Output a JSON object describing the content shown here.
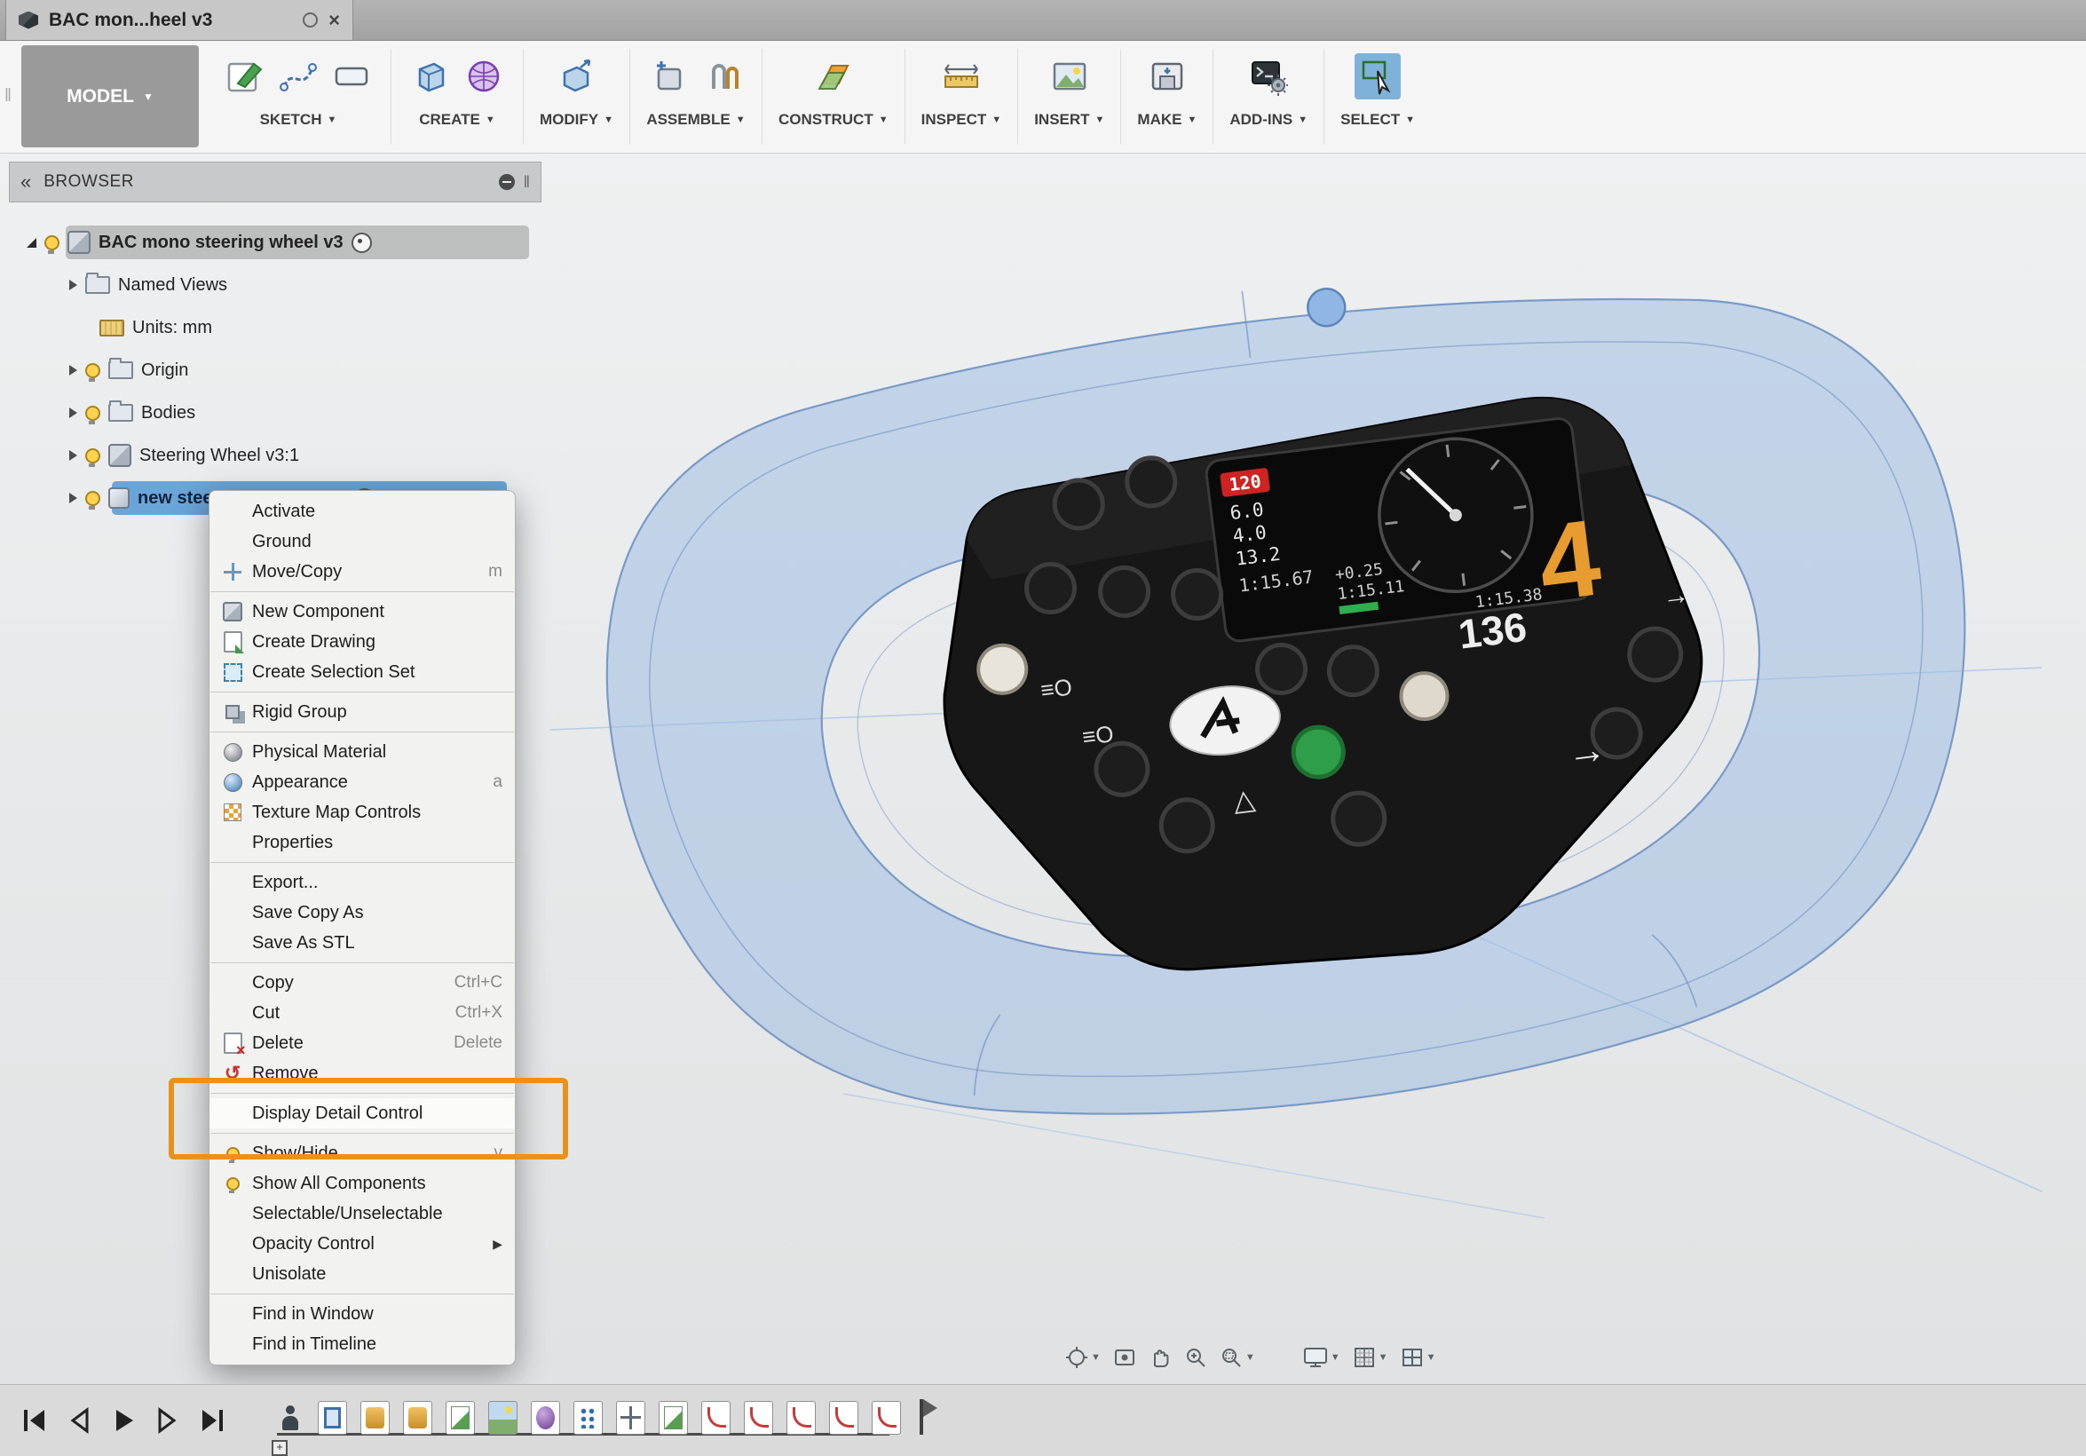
{
  "window": {
    "tab_title": "BAC mon...heel v3"
  },
  "toolbar": {
    "workspace_label": "MODEL",
    "menus": [
      {
        "label": "SKETCH"
      },
      {
        "label": "CREATE"
      },
      {
        "label": "MODIFY"
      },
      {
        "label": "ASSEMBLE"
      },
      {
        "label": "CONSTRUCT"
      },
      {
        "label": "INSPECT"
      },
      {
        "label": "INSERT"
      },
      {
        "label": "MAKE"
      },
      {
        "label": "ADD-INS"
      },
      {
        "label": "SELECT"
      }
    ]
  },
  "browser": {
    "header": "BROWSER",
    "items": [
      {
        "label": "BAC mono steering wheel v3"
      },
      {
        "label": "Named Views"
      },
      {
        "label": "Units: mm"
      },
      {
        "label": "Origin"
      },
      {
        "label": "Bodies"
      },
      {
        "label": "Steering Wheel v3:1"
      },
      {
        "label": "new steering wheel cove"
      }
    ]
  },
  "context_menu": {
    "items": [
      {
        "label": "Activate"
      },
      {
        "label": "Ground"
      },
      {
        "label": "Move/Copy",
        "shortcut": "m"
      },
      {
        "label": "New Component"
      },
      {
        "label": "Create Drawing"
      },
      {
        "label": "Create Selection Set"
      },
      {
        "label": "Rigid Group"
      },
      {
        "label": "Physical Material"
      },
      {
        "label": "Appearance",
        "shortcut": "a"
      },
      {
        "label": "Texture Map Controls"
      },
      {
        "label": "Properties"
      },
      {
        "label": "Export..."
      },
      {
        "label": "Save Copy As"
      },
      {
        "label": "Save As STL"
      },
      {
        "label": "Copy",
        "shortcut": "Ctrl+C"
      },
      {
        "label": "Cut",
        "shortcut": "Ctrl+X"
      },
      {
        "label": "Delete",
        "shortcut": "Delete"
      },
      {
        "label": "Remove"
      },
      {
        "label": "Display Detail Control"
      },
      {
        "label": "Show/Hide",
        "shortcut": "v"
      },
      {
        "label": "Show All Components"
      },
      {
        "label": "Selectable/Unselectable"
      },
      {
        "label": "Opacity Control"
      },
      {
        "label": "Unisolate"
      },
      {
        "label": "Find in Window"
      },
      {
        "label": "Find in Timeline"
      }
    ],
    "highlighted_item": "Display Detail Control",
    "highlight_color": "#E8921C"
  },
  "viewport": {
    "hud": {
      "badge": "120",
      "gear": "4",
      "speed": "136",
      "row1": "6.0",
      "row2": "4.0",
      "row3": "13.2",
      "lap1": "1:15.67",
      "delta": "+0.25",
      "lap2": "1:15.11",
      "lap3": "1:15.38"
    }
  },
  "navbar": {
    "icons": [
      "orbit",
      "look-at",
      "pan",
      "zoom",
      "zoom-window",
      "display-settings",
      "grid-settings",
      "viewports"
    ]
  },
  "timeline": {
    "playback": [
      "go-to-start",
      "step-back",
      "play",
      "step-forward",
      "go-to-end"
    ],
    "features": [
      "component-position-marker",
      "box-feature",
      "extrude",
      "revolve",
      "sketch",
      "decal",
      "form-body",
      "pattern",
      "move",
      "sketch",
      "fillet",
      "fillet",
      "fillet",
      "fillet",
      "fillet",
      "end-of-timeline-marker"
    ]
  }
}
